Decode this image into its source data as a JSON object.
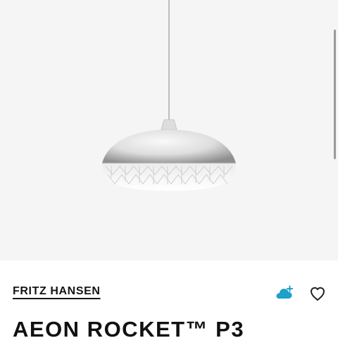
{
  "product": {
    "brand": "FRITZ HANSEN",
    "title": "AEON ROCKET™ P3",
    "image_subject": "pendant-lamp"
  },
  "actions": {
    "cloud_icon": "cloud-plus-icon",
    "favorite_icon": "heart-icon"
  },
  "colors": {
    "hero_background": "#f5f5f5",
    "accent_cloud": "#1ea0c8",
    "text": "#151515"
  }
}
